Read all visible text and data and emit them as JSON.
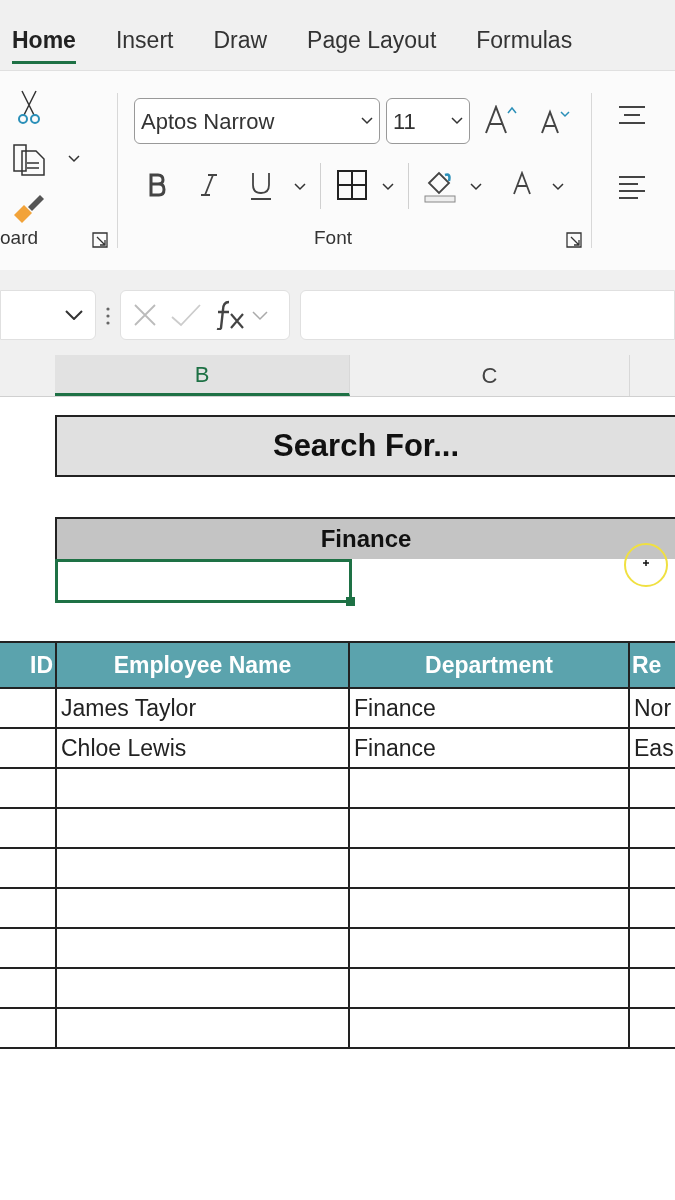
{
  "ribbon_tabs": [
    {
      "label": "Home",
      "selected": true
    },
    {
      "label": "Insert",
      "selected": false
    },
    {
      "label": "Draw",
      "selected": false
    },
    {
      "label": "Page Layout",
      "selected": false
    },
    {
      "label": "Formulas",
      "selected": false
    }
  ],
  "ribbon": {
    "clipboard_group": {
      "label": "oard"
    },
    "font_group": {
      "label": "Font",
      "font_name": "Aptos Narrow",
      "font_size": "11"
    }
  },
  "column_headers": [
    {
      "label": "B",
      "selected": true
    },
    {
      "label": "C",
      "selected": false
    }
  ],
  "sheet": {
    "search_title": "Search For...",
    "filter_header": "Finance",
    "input_cell": {
      "selected": true
    },
    "table": {
      "columns": [
        "ID",
        "Employee Name",
        "Department",
        "Re"
      ],
      "rows": [
        {
          "employee_name": "James Taylor",
          "department": "Finance",
          "column_4": "Nor"
        },
        {
          "employee_name": "Chloe Lewis",
          "department": "Finance",
          "column_4": "Eas"
        }
      ]
    }
  }
}
